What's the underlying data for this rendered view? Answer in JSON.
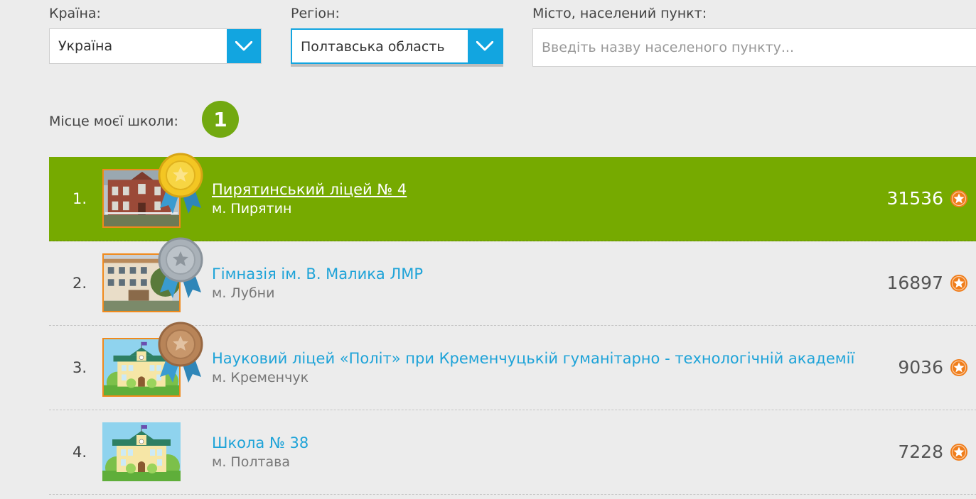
{
  "filters": {
    "country_label": "Країна:",
    "country_value": "Україна",
    "region_label": "Регіон:",
    "region_value": "Полтавська область",
    "city_label": "Місто, населений пункт:",
    "city_placeholder": "Введіть назву населеного пункту..."
  },
  "my_school": {
    "label": "Місце моєї школи:",
    "rank": "1"
  },
  "schools": [
    {
      "rank": "1.",
      "name": "Пирятинський ліцей № 4",
      "city": "м. Пирятин",
      "score": "31536",
      "medal": "gold",
      "photo": "brick-building",
      "highlighted": true
    },
    {
      "rank": "2.",
      "name": "Гімназія ім. В. Малика ЛМР",
      "city": "м. Лубни",
      "score": "16897",
      "medal": "silver",
      "photo": "school-building",
      "highlighted": false
    },
    {
      "rank": "3.",
      "name": "Науковий ліцей «Політ» при Кременчуцькій гуманітарно - технологічній академії",
      "city": "м. Кременчук",
      "score": "9036",
      "medal": "bronze",
      "photo": "school-illustration",
      "highlighted": false
    },
    {
      "rank": "4.",
      "name": "Школа № 38",
      "city": "м. Полтава",
      "score": "7228",
      "medal": "none",
      "photo": "school-illustration",
      "highlighted": false
    }
  ],
  "colors": {
    "accent_blue": "#12a5e0",
    "highlight_green": "#76aa00",
    "star_orange": "#f07d1a",
    "gold": "#f3c623",
    "silver": "#a9b1b8",
    "bronze": "#b88458"
  },
  "icons": [
    "chevron-down-icon",
    "star-icon",
    "gold-medal-icon",
    "silver-medal-icon",
    "bronze-medal-icon"
  ]
}
